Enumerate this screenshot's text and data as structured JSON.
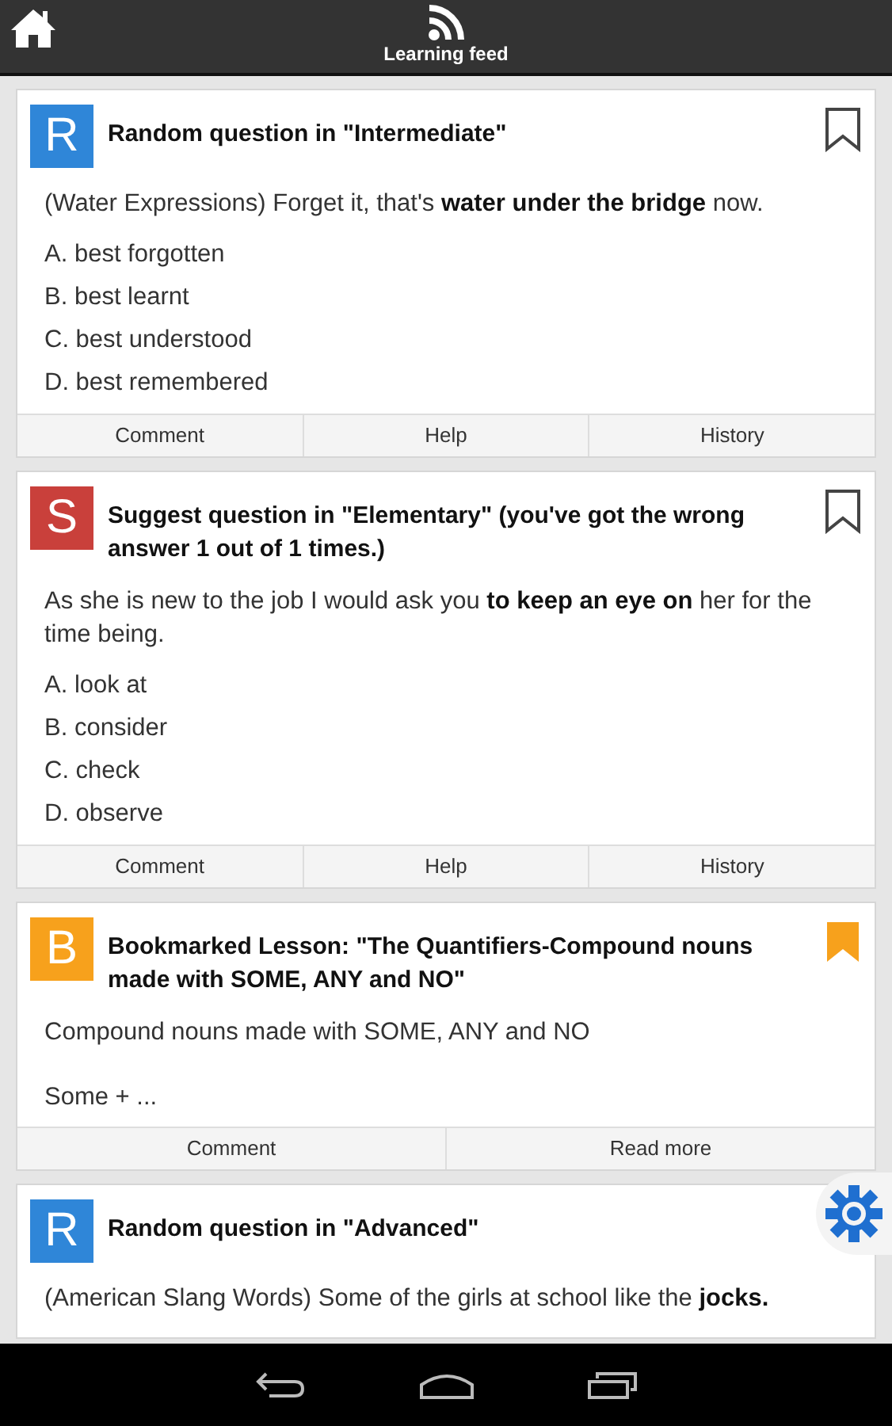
{
  "top_bar": {
    "title": "Learning feed"
  },
  "cards": [
    {
      "kind": "question",
      "badge": "R",
      "color": "#2f86d8",
      "title": "Random question in \"Intermediate\"",
      "bookmarked": false,
      "text": "(Water Expressions) Forget it, that's **water under the bridge** now.",
      "options": [
        "A. best forgotten",
        "B. best learnt",
        "C. best understood",
        "D. best remembered"
      ],
      "actions": [
        "Comment",
        "Help",
        "History"
      ]
    },
    {
      "kind": "question",
      "badge": "S",
      "color": "#c9403b",
      "title": "Suggest question in \"Elementary\" (you've got the wrong answer 1 out of 1 times.)",
      "bookmarked": false,
      "text": "As she is new to the job I would ask you **to keep an eye on** her for the time being.",
      "options": [
        "A. look at",
        "B. consider",
        "C. check",
        "D. observe"
      ],
      "actions": [
        "Comment",
        "Help",
        "History"
      ]
    },
    {
      "kind": "lesson",
      "badge": "B",
      "color": "#f7a11c",
      "title": "Bookmarked Lesson: \"The Quantifiers-Compound nouns made with SOME, ANY and NO\"",
      "bookmarked": true,
      "paragraphs": [
        "Compound nouns made with SOME, ANY and NO",
        "Some + ..."
      ],
      "actions": [
        "Comment",
        "Read more"
      ]
    },
    {
      "kind": "question",
      "badge": "R",
      "color": "#2f86d8",
      "title": "Random question in \"Advanced\"",
      "text": "(American Slang Words) Some of the girls at school like the **jocks.**"
    }
  ]
}
